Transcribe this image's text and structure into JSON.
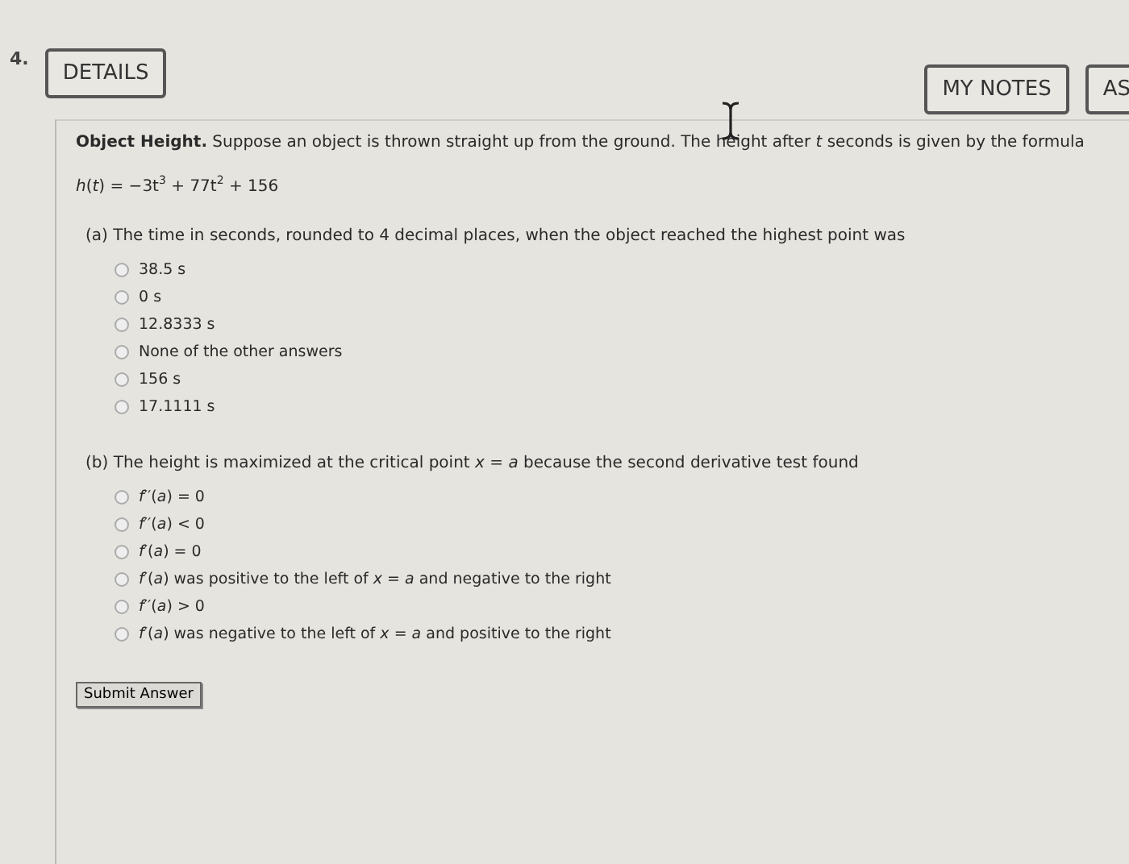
{
  "question": {
    "number": "4.",
    "buttons": [
      {
        "label": "DETAILS"
      },
      {
        "label": "MY NOTES"
      },
      {
        "label": "AS"
      }
    ]
  },
  "intro": "**Object Height.** Suppose an object is thrown straight up from the ground. The height after *t* seconds is given by the formula",
  "formula": "*h*(*t*) = −3t$^{3}$ + 77t$^{2}$ + 156",
  "parts": [
    {
      "prompt": "(a) The time in seconds, rounded to 4 decimal places, when the object reached the highest point was",
      "options": [
        {
          "label": "38.5 s",
          "selected": false
        },
        {
          "label": "0 s",
          "selected": false
        },
        {
          "label": "12.8333 s",
          "selected": false
        },
        {
          "label": "None of the other answers",
          "selected": false
        },
        {
          "label": "156 s",
          "selected": false
        },
        {
          "label": "17.1111 s",
          "selected": false
        }
      ]
    },
    {
      "prompt": "(b) The height is maximized at the critical point *x* = *a* because the second derivative test found",
      "options": [
        {
          "label": "*f*′′(*a*) = 0",
          "selected": false
        },
        {
          "label": "*f*′′(*a*) < 0",
          "selected": false
        },
        {
          "label": "*f*′(*a*) = 0",
          "selected": false
        },
        {
          "label": "*f*′(*a*) was positive to the left of *x* = *a* and negative to the right",
          "selected": false
        },
        {
          "label": "*f*′′(*a*) > 0",
          "selected": false
        },
        {
          "label": "*f*′(*a*) was negative to the left of *x* = *a* and positive to the right",
          "selected": false
        }
      ]
    }
  ],
  "submit": "Submit Answer"
}
